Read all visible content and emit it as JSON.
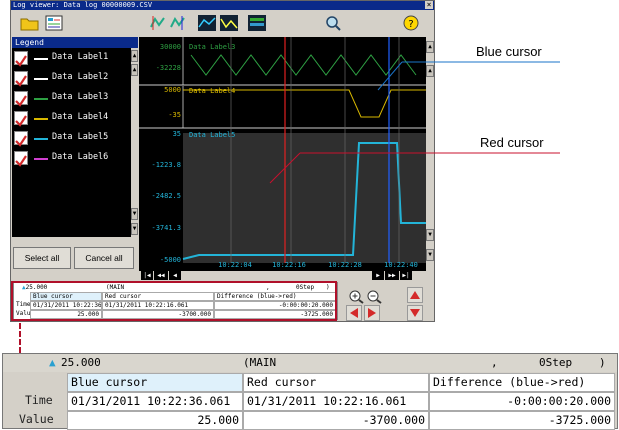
{
  "window": {
    "title": "Log viewer: Data log 00000009.CSV",
    "close_label": "×"
  },
  "toolbar": {
    "icons": [
      "open-folder-icon",
      "file-list-icon",
      "cursor-left-icon",
      "cursor-right-icon",
      "waveform-icon",
      "trend-icon",
      "table-icon",
      "search-icon",
      "help-icon"
    ],
    "help_label": "?"
  },
  "legend": {
    "title": "Legend",
    "items": [
      {
        "label": "Data Label1",
        "color": "#ffffff"
      },
      {
        "label": "Data Label2",
        "color": "#ffffff"
      },
      {
        "label": "Data Label3",
        "color": "#2ea043"
      },
      {
        "label": "Data Label4",
        "color": "#d8b800"
      },
      {
        "label": "Data Label5",
        "color": "#23b4d8"
      },
      {
        "label": "Data Label6",
        "color": "#d040d0"
      }
    ],
    "select_all_label": "Select all",
    "cancel_all_label": "Cancel all"
  },
  "chart": {
    "panels": [
      {
        "label": "Data Label3",
        "scale_max": "30000",
        "scale_min": "-32228",
        "color": "#2ea043"
      },
      {
        "label": "Data Label4",
        "scale_max": "5000",
        "scale_min": "-35",
        "color": "#d8b800"
      },
      {
        "label": "Data Label5",
        "scale_ticks": [
          "35",
          "-1223.8",
          "-2482.5",
          "-3741.3",
          "-5000"
        ],
        "color": "#23b4d8"
      }
    ],
    "time_ticks": [
      "10:22:04",
      "10:22:16",
      "10:22:28",
      "10:22:40"
    ],
    "red_cursor_color": "#e02020",
    "blue_cursor_color": "#2060ff"
  },
  "nav": {
    "first": "|◀",
    "prev_page": "◀◀",
    "prev": "◀",
    "next": "▶",
    "next_page": "▶▶",
    "last": "▶|"
  },
  "info": {
    "marker_value": "25.000",
    "group": "(MAIN",
    "comma": ",",
    "step": "0Step",
    "close_paren": ")",
    "col_blue": "Blue cursor",
    "col_red": "Red cursor",
    "col_diff": "Difference (blue->red)",
    "row_time": "Time",
    "row_value": "Value",
    "blue_time": "01/31/2011 10:22:36.061",
    "red_time": "01/31/2011 10:22:16.061",
    "diff_time": "-0:00:00:20.000",
    "blue_value": "25.000",
    "red_value": "-3700.000",
    "diff_value": "-3725.000"
  },
  "callouts": {
    "blue": "Blue cursor",
    "red": "Red cursor"
  },
  "colors": {
    "highlight": "#b0102a",
    "callout_blue": "#1a73c8",
    "callout_red": "#c8102e"
  }
}
